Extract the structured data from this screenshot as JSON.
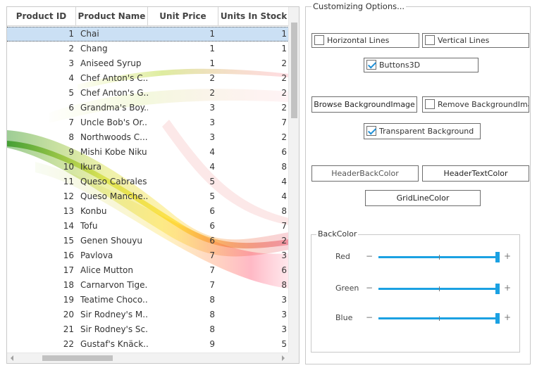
{
  "grid": {
    "columns": [
      "Product ID",
      "Product Name",
      "Unit Price",
      "Units In Stock"
    ],
    "rows": [
      [
        "1",
        "Chai",
        "1",
        "1"
      ],
      [
        "2",
        "Chang",
        "1",
        "1"
      ],
      [
        "3",
        "Aniseed Syrup",
        "1",
        "2"
      ],
      [
        "4",
        "Chef Anton's C...",
        "2",
        "2"
      ],
      [
        "5",
        "Chef Anton's G...",
        "2",
        "2"
      ],
      [
        "6",
        "Grandma's Boy...",
        "3",
        "2"
      ],
      [
        "7",
        "Uncle Bob's Or...",
        "3",
        "7"
      ],
      [
        "8",
        "Northwoods C...",
        "3",
        "2"
      ],
      [
        "9",
        "Mishi Kobe Niku",
        "4",
        "6"
      ],
      [
        "10",
        "Ikura",
        "4",
        "8"
      ],
      [
        "11",
        "Queso Cabrales",
        "5",
        "4"
      ],
      [
        "12",
        "Queso Manche...",
        "5",
        "4"
      ],
      [
        "13",
        "Konbu",
        "6",
        "8"
      ],
      [
        "14",
        "Tofu",
        "6",
        "7"
      ],
      [
        "15",
        "Genen Shouyu",
        "6",
        "2"
      ],
      [
        "16",
        "Pavlova",
        "7",
        "3"
      ],
      [
        "17",
        "Alice Mutton",
        "7",
        "6"
      ],
      [
        "18",
        "Carnarvon Tige...",
        "7",
        "8"
      ],
      [
        "19",
        "Teatime Choco...",
        "8",
        "3"
      ],
      [
        "20",
        "Sir Rodney's M...",
        "8",
        "3"
      ],
      [
        "21",
        "Sir Rodney's Sc...",
        "8",
        "3"
      ],
      [
        "22",
        "Gustaf's Knäck...",
        "9",
        "5"
      ]
    ],
    "selected_row": 0
  },
  "options": {
    "title": "Customizing Options...",
    "horizontal_lines": {
      "label": "Horizontal Lines",
      "checked": false
    },
    "vertical_lines": {
      "label": "Vertical Lines",
      "checked": false
    },
    "buttons3d": {
      "label": "Buttons3D",
      "checked": true
    },
    "browse_bg": "Browse BackgroundImage",
    "remove_bg": {
      "label": "Remove BackgroundImag",
      "checked": false
    },
    "transparent_bg": {
      "label": "Transparent Background",
      "checked": true
    },
    "header_back_color": "HeaderBackColor",
    "header_text_color": "HeaderTextColor",
    "grid_line_color": "GridLineColor",
    "backcolor": {
      "title": "BackColor",
      "minus": "−",
      "plus": "+",
      "sliders": [
        {
          "label": "Red",
          "value": 255,
          "max": 255
        },
        {
          "label": "Green",
          "value": 255,
          "max": 255
        },
        {
          "label": "Blue",
          "value": 255,
          "max": 255
        }
      ]
    }
  },
  "colors": {
    "accent": "#1ba1e2",
    "selection": "#bad6f0",
    "check": "#1e8fd6"
  }
}
